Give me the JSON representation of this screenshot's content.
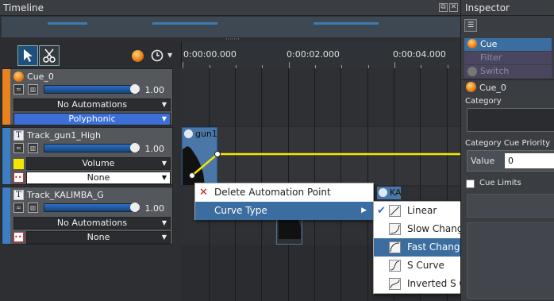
{
  "timeline": {
    "title": "Timeline"
  },
  "ruler": {
    "ticks": [
      "0:00:00.000",
      "0:00:02.000",
      "0:00:04.000"
    ]
  },
  "tracks": [
    {
      "name": "Cue_0",
      "volume": "1.00",
      "automation": "No Automations",
      "mode": "Polyphonic",
      "accent": "#e8821e"
    },
    {
      "name": "Track_gun1_High",
      "volume": "1.00",
      "automation": "Volume",
      "extra": "None",
      "accent": "#3c7dc4"
    },
    {
      "name": "Track_KALIMBA_G",
      "volume": "1.00",
      "automation": "No Automations",
      "extra": "None",
      "accent": "#3c7dc4"
    }
  ],
  "clips": {
    "gun": "gun1",
    "kalimba": "KA"
  },
  "context_menu": {
    "delete": "Delete Automation Point",
    "curve_type": "Curve Type"
  },
  "submenu": {
    "items": [
      "Linear",
      "Slow Change",
      "Fast Change",
      "S Curve",
      "Inverted S Curve"
    ],
    "checked": "Linear",
    "highlighted": "Fast Change"
  },
  "inspector": {
    "title": "Inspector",
    "cue_btn": "Cue",
    "filter_btn": "Filter",
    "switch_btn": "Switch",
    "cue_name": "Cue_0",
    "category_label": "Category",
    "priority_label": "Category Cue Priority",
    "value_label": "Value",
    "value": "0",
    "limits_label": "Cue Limits"
  },
  "colors": {
    "accent_blue": "#3b6da0",
    "automation_line": "#f4e600",
    "cue_orange": "#e8821e"
  }
}
